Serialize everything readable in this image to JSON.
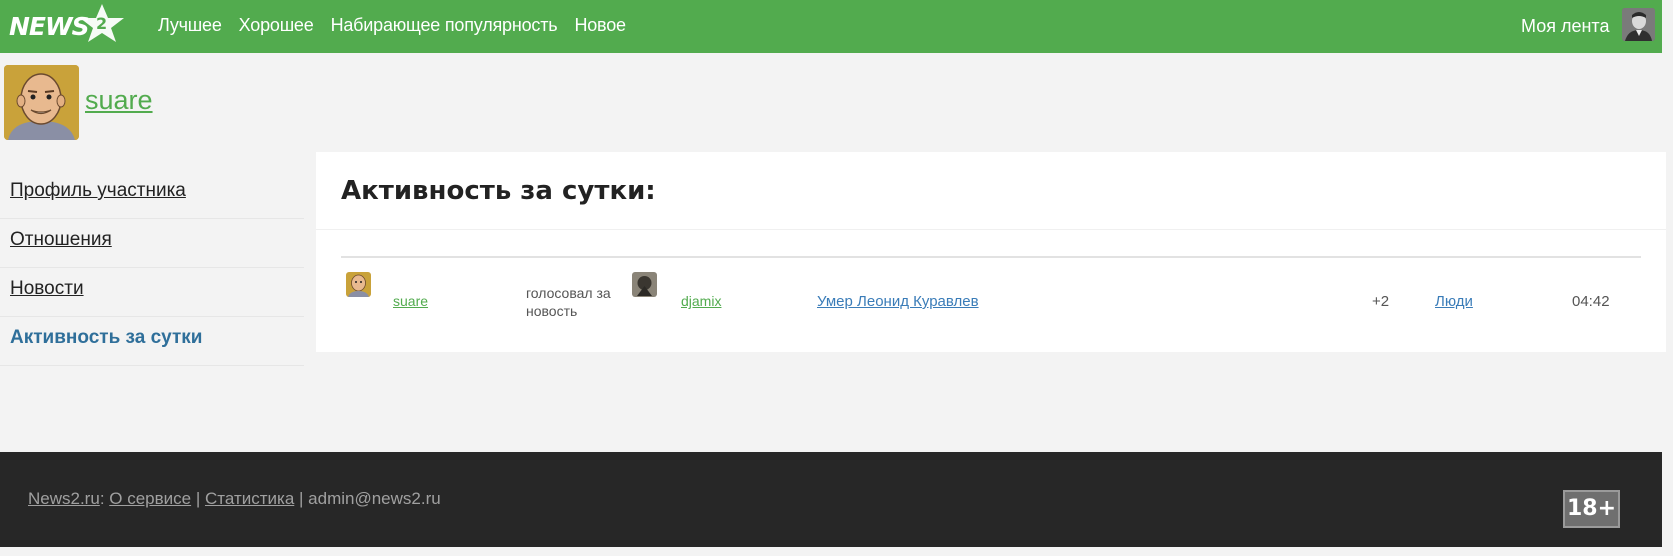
{
  "header": {
    "logo_text": "NEWS",
    "logo_badge": "2",
    "nav": [
      "Лучшее",
      "Хорошее",
      "Набирающее популярность",
      "Новое"
    ],
    "my_feed": "Моя лента"
  },
  "profile": {
    "username": "suare"
  },
  "sidebar": {
    "items": [
      {
        "label": "Профиль участника",
        "active": false
      },
      {
        "label": "Отношения",
        "active": false
      },
      {
        "label": "Новости",
        "active": false
      },
      {
        "label": "Активность за сутки",
        "active": true
      }
    ]
  },
  "main": {
    "title": "Активность за сутки:",
    "activity": [
      {
        "actor": "suare",
        "action": "голосовал за новость",
        "target_user": "djamix",
        "news_title": "Умер Леонид Куравлев",
        "score": "+2",
        "category": "Люди",
        "time": "04:42"
      }
    ]
  },
  "footer": {
    "site": "News2.ru",
    "about": "О сервисе",
    "stats": "Статистика",
    "email": "admin@news2.ru",
    "age_badge": "18+"
  },
  "colors": {
    "brand_green": "#52ab4e",
    "link_blue": "#3a7cb8",
    "footer_bg": "#272727"
  }
}
